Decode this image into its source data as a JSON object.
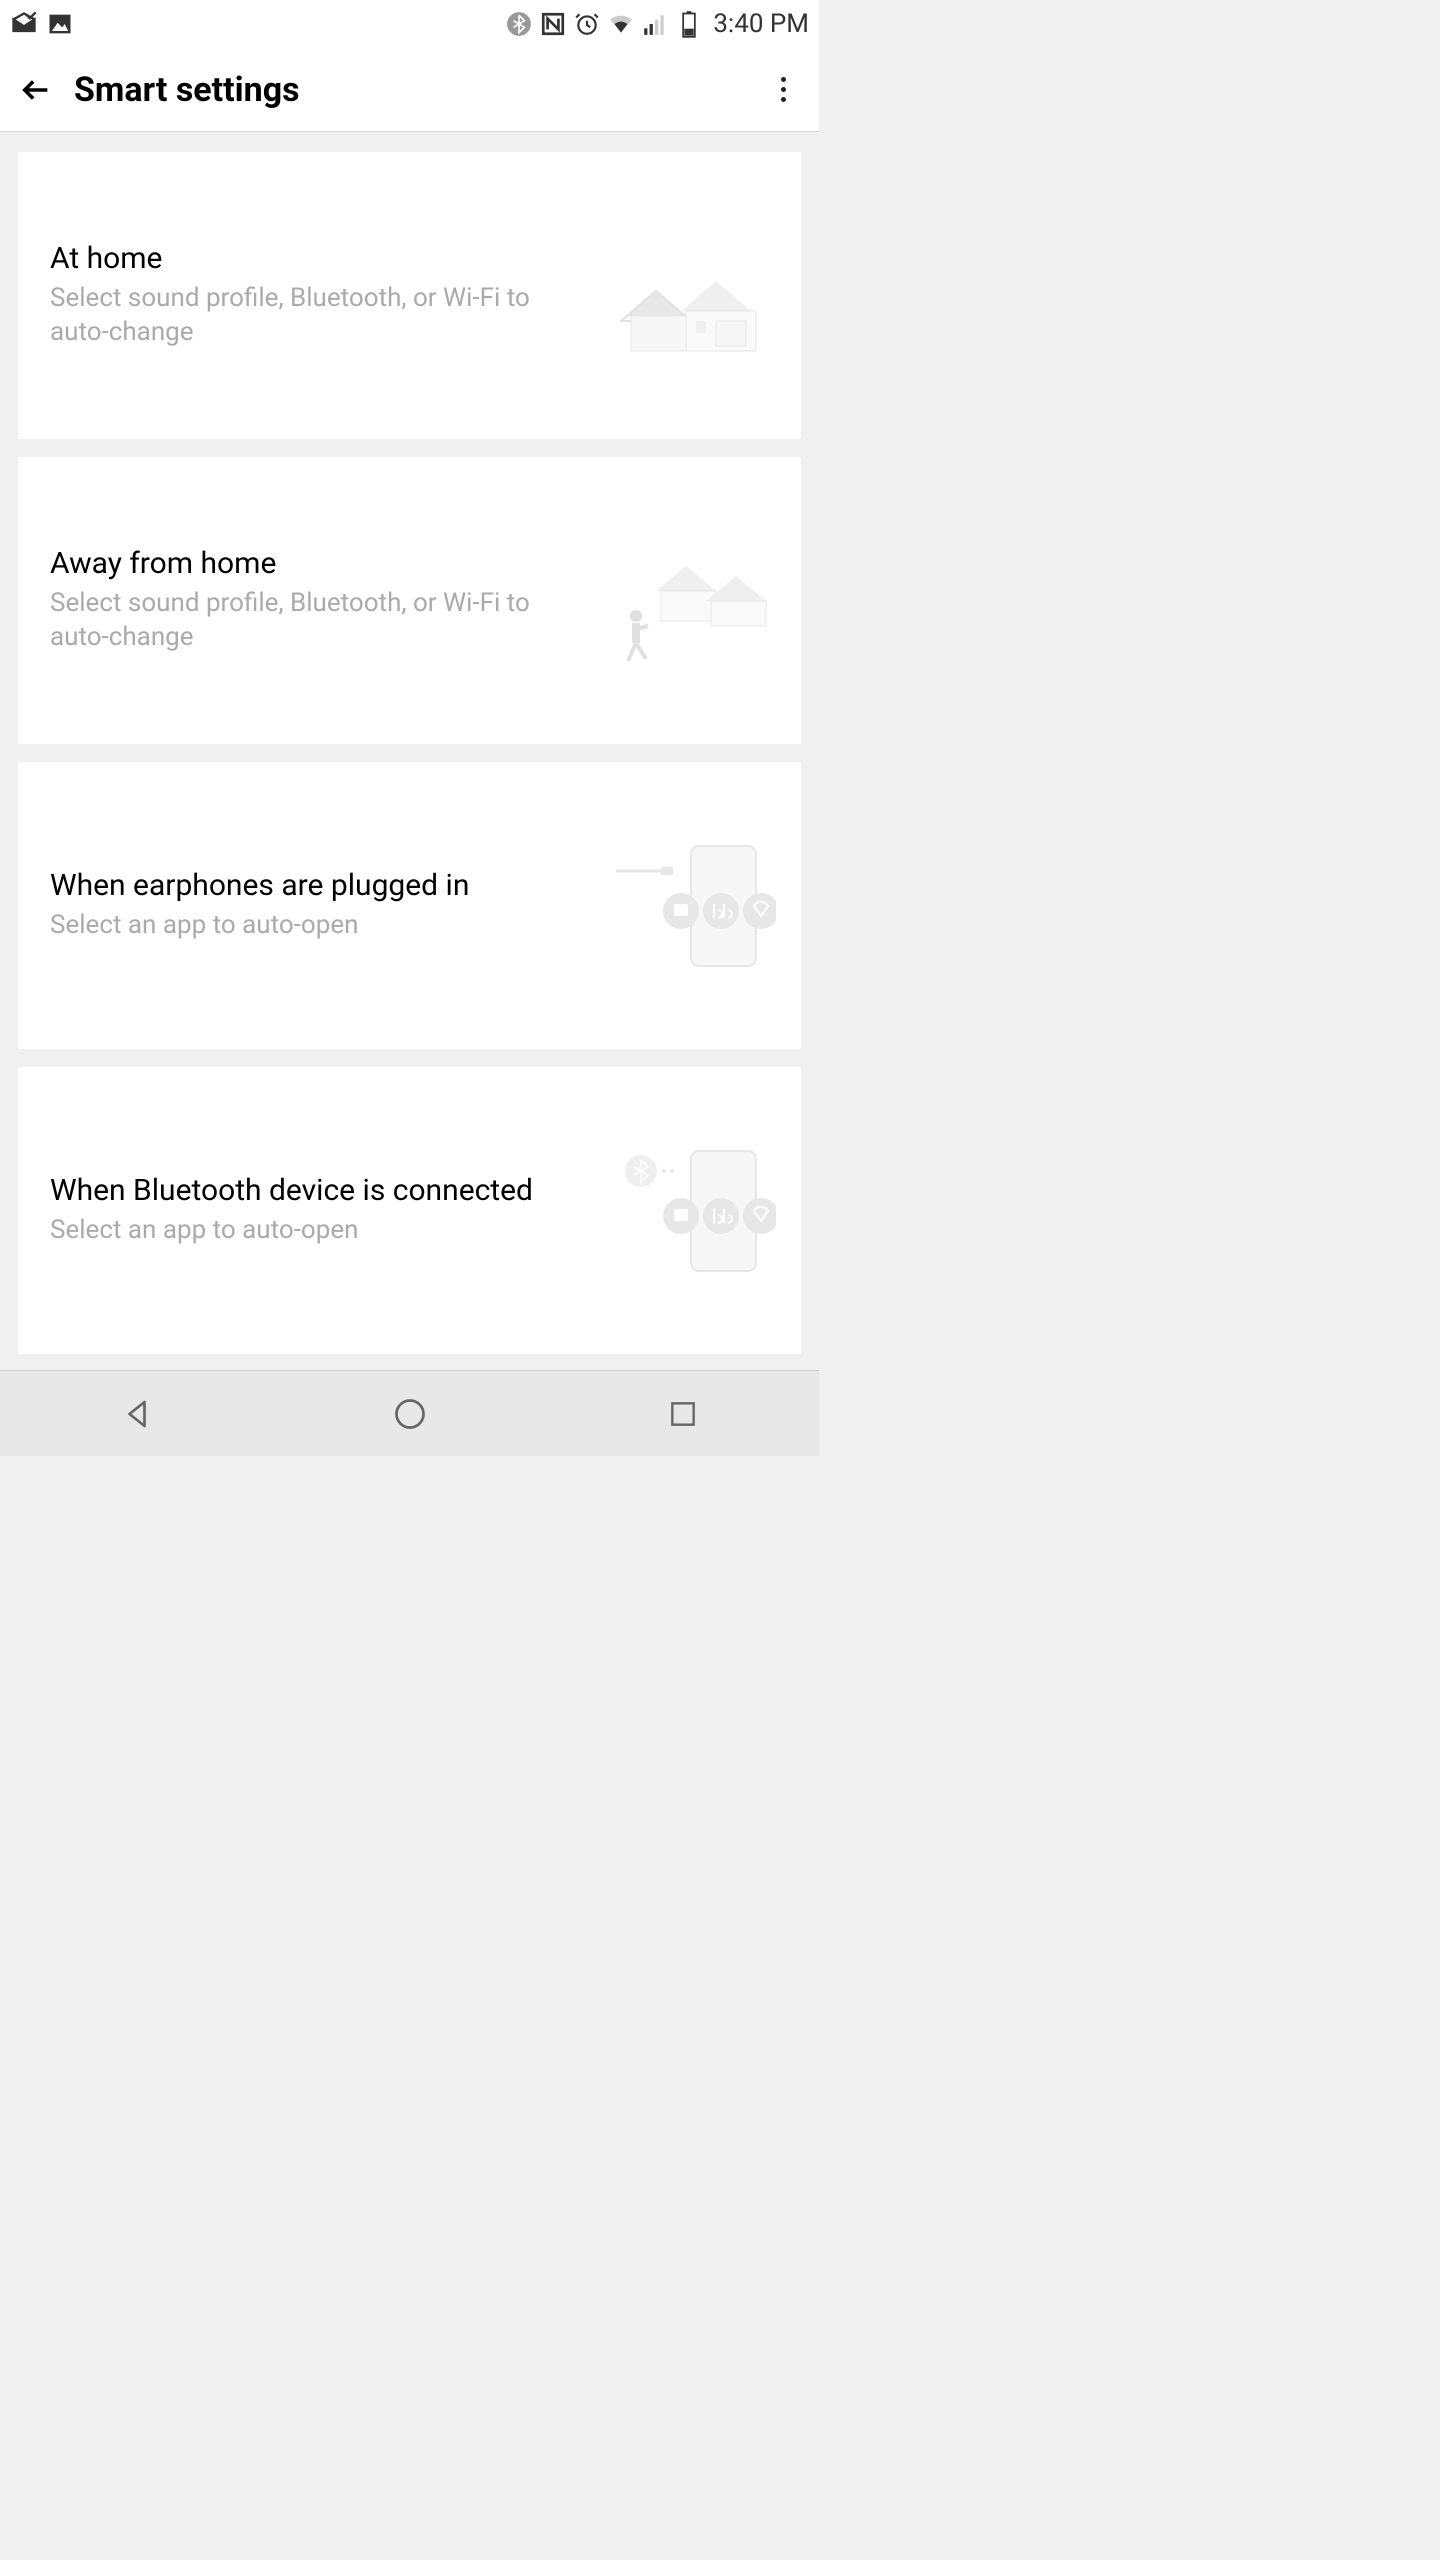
{
  "status": {
    "time": "3:40 PM",
    "icons": {
      "mail": "mail-icon",
      "gallery": "gallery-icon",
      "bluetooth": "bluetooth-icon",
      "nfc": "nfc-icon",
      "alarm": "alarm-icon",
      "wifi": "wifi-icon",
      "signal": "signal-icon",
      "battery": "battery-icon"
    }
  },
  "header": {
    "title": "Smart settings"
  },
  "cards": [
    {
      "title": "At home",
      "subtitle": "Select sound profile, Bluetooth, or Wi-Fi to auto-change"
    },
    {
      "title": "Away from home",
      "subtitle": "Select sound profile, Bluetooth, or Wi-Fi to auto-change"
    },
    {
      "title": "When earphones are plugged in",
      "subtitle": "Select an app to auto-open"
    },
    {
      "title": "When Bluetooth device is connected",
      "subtitle": "Select an app to auto-open"
    }
  ]
}
